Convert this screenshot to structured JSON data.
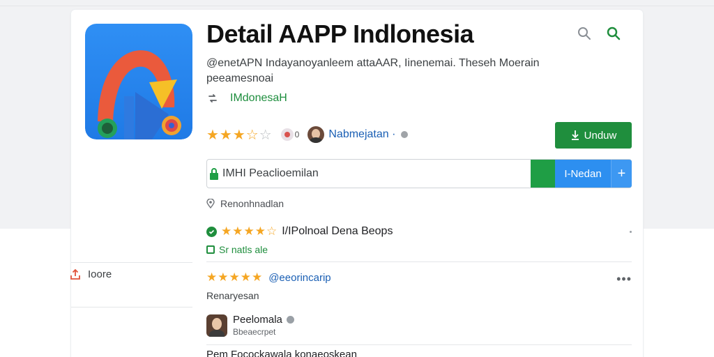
{
  "app": {
    "title": "Detail AAPP Indlonesia",
    "description": "@enetAPN Indayanoyanleem attaAAR, Iinenemai. Theseh Moerain peeamesnoai",
    "developer": "IMdonesaH",
    "rating_extra": "0",
    "publisher": "Nabmejatan ·"
  },
  "header_icons": {
    "grey": "search-icon",
    "green": "search-icon"
  },
  "actions": {
    "download_label": "Unduw"
  },
  "install_bar": {
    "text": "IMHI Peaclioemilan",
    "button_label": "I-Nedan",
    "plus_label": "+"
  },
  "location": {
    "text": "Renonhnadlan"
  },
  "review_summary": {
    "label": "I/IPolnoal Dena Beops"
  },
  "status": {
    "text": "Sr natls ale"
  },
  "side": {
    "share_label": "Ioore"
  },
  "review": {
    "handle": "@eeorincarip",
    "subtitle": "Renaryesan",
    "more_label": "•••",
    "reviewer_name": "Peelomala",
    "reviewer_sub": "Bbeaecrpet",
    "body": "Pem Focockawala konaeoskean"
  },
  "colors": {
    "accent_green": "#1f8e3d",
    "accent_blue": "#2d8ff0",
    "star": "#f5a623",
    "link_blue": "#1a5fb4"
  }
}
